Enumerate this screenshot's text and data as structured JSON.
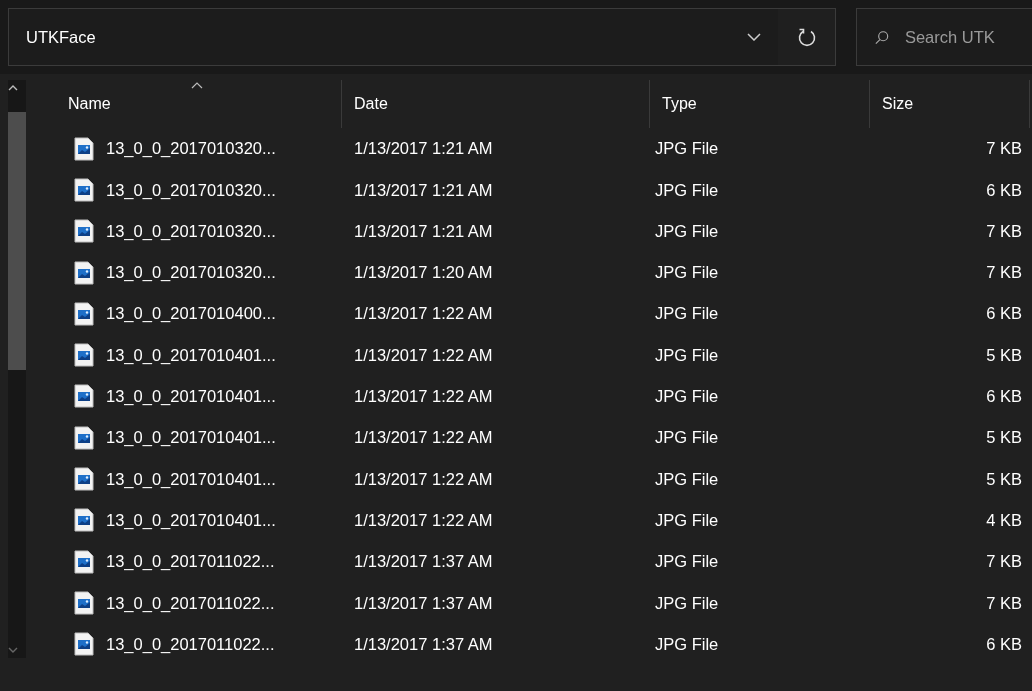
{
  "address_bar": {
    "path": "UTKFace"
  },
  "search": {
    "placeholder": "Search UTK"
  },
  "table": {
    "columns": [
      {
        "label": "Name",
        "sorted": true
      },
      {
        "label": "Date",
        "sorted": false
      },
      {
        "label": "Type",
        "sorted": false
      },
      {
        "label": "Size",
        "sorted": false
      }
    ],
    "rows": [
      {
        "name": "13_0_0_2017010320...",
        "date": "1/13/2017 1:21 AM",
        "type": "JPG File",
        "size": "7 KB"
      },
      {
        "name": "13_0_0_2017010320...",
        "date": "1/13/2017 1:21 AM",
        "type": "JPG File",
        "size": "6 KB"
      },
      {
        "name": "13_0_0_2017010320...",
        "date": "1/13/2017 1:21 AM",
        "type": "JPG File",
        "size": "7 KB"
      },
      {
        "name": "13_0_0_2017010320...",
        "date": "1/13/2017 1:20 AM",
        "type": "JPG File",
        "size": "7 KB"
      },
      {
        "name": "13_0_0_2017010400...",
        "date": "1/13/2017 1:22 AM",
        "type": "JPG File",
        "size": "6 KB"
      },
      {
        "name": "13_0_0_2017010401...",
        "date": "1/13/2017 1:22 AM",
        "type": "JPG File",
        "size": "5 KB"
      },
      {
        "name": "13_0_0_2017010401...",
        "date": "1/13/2017 1:22 AM",
        "type": "JPG File",
        "size": "6 KB"
      },
      {
        "name": "13_0_0_2017010401...",
        "date": "1/13/2017 1:22 AM",
        "type": "JPG File",
        "size": "5 KB"
      },
      {
        "name": "13_0_0_2017010401...",
        "date": "1/13/2017 1:22 AM",
        "type": "JPG File",
        "size": "5 KB"
      },
      {
        "name": "13_0_0_2017010401...",
        "date": "1/13/2017 1:22 AM",
        "type": "JPG File",
        "size": "4 KB"
      },
      {
        "name": "13_0_0_2017011022...",
        "date": "1/13/2017 1:37 AM",
        "type": "JPG File",
        "size": "7 KB"
      },
      {
        "name": "13_0_0_2017011022...",
        "date": "1/13/2017 1:37 AM",
        "type": "JPG File",
        "size": "7 KB"
      },
      {
        "name": "13_0_0_2017011022...",
        "date": "1/13/2017 1:37 AM",
        "type": "JPG File",
        "size": "6 KB"
      }
    ]
  }
}
